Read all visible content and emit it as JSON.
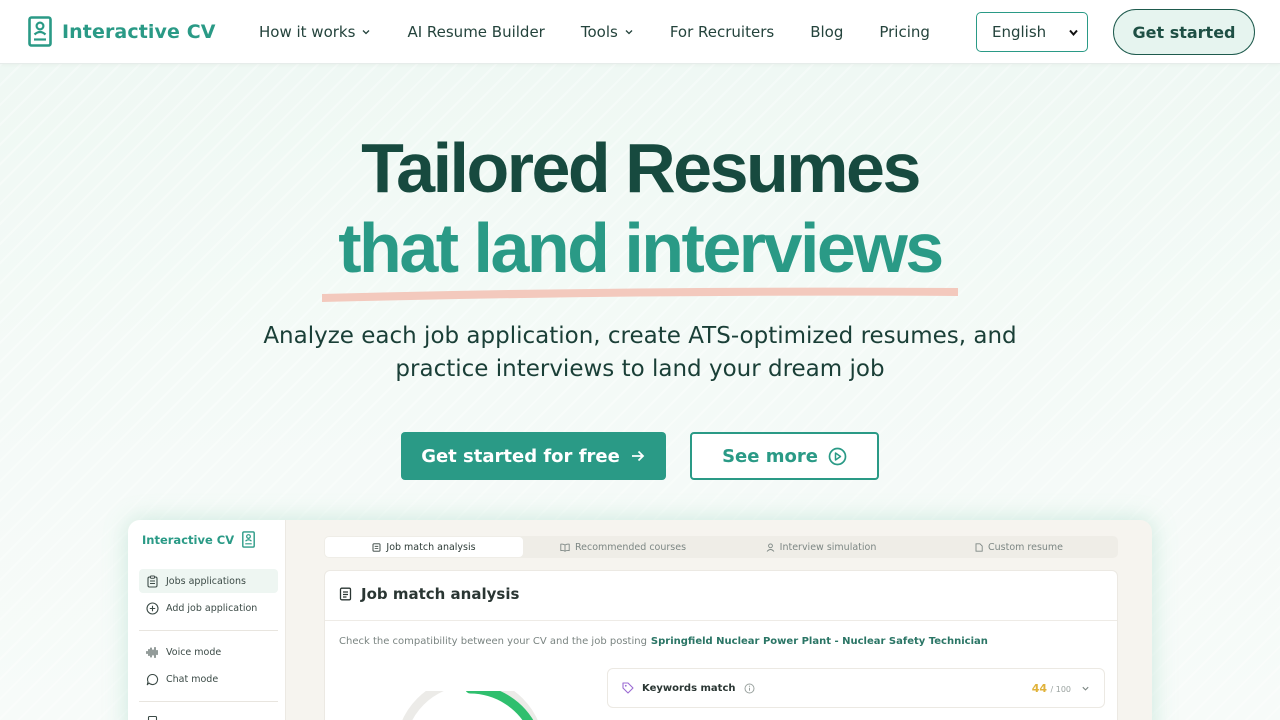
{
  "header": {
    "brand": "Interactive CV",
    "nav": [
      {
        "label": "How it works",
        "dropdown": true
      },
      {
        "label": "AI Resume Builder",
        "dropdown": false
      },
      {
        "label": "Tools",
        "dropdown": true
      },
      {
        "label": "For Recruiters",
        "dropdown": false
      },
      {
        "label": "Blog",
        "dropdown": false
      },
      {
        "label": "Pricing",
        "dropdown": false
      }
    ],
    "language": "English",
    "cta": "Get started"
  },
  "hero": {
    "title_line1": "Tailored Resumes",
    "title_line2": "that land interviews",
    "subtitle": "Analyze each job application, create ATS-optimized resumes, and practice interviews to land your dream job",
    "cta_primary": "Get started for free",
    "cta_secondary": "See more"
  },
  "preview": {
    "brand": "Interactive CV",
    "sidebar": {
      "items": [
        "Jobs applications",
        "Add job application",
        "Voice mode",
        "Chat mode"
      ]
    },
    "tabs": [
      "Job match analysis",
      "Recommended courses",
      "Interview simulation",
      "Custom resume"
    ],
    "card_title": "Job match analysis",
    "check_text": "Check the compatibility between your CV and the job posting",
    "job_name": "Springfield Nuclear Power Plant - Nuclear Safety Technician",
    "keywords_label": "Keywords match",
    "keywords_score": "44",
    "keywords_max": "/ 100"
  },
  "colors": {
    "accent": "#2a9a86",
    "dark": "#174a3f",
    "underline": "#f3c9bd",
    "score": "#e0b23a"
  }
}
